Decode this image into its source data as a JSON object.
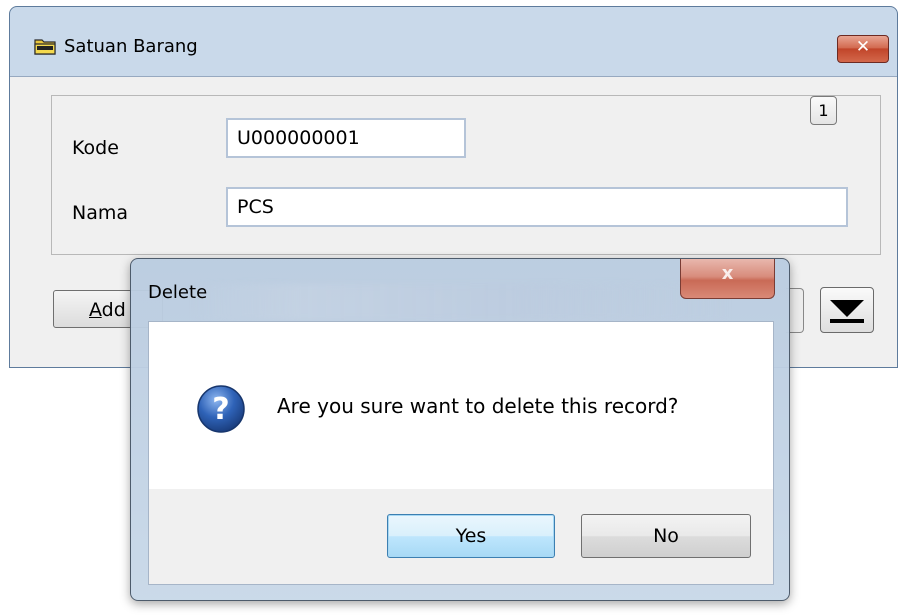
{
  "window": {
    "title": "Satuan Barang",
    "close_label": "✕"
  },
  "form": {
    "kode_label": "Kode",
    "kode_value": "U000000001",
    "nama_label": "Nama",
    "nama_value": "PCS",
    "record_number": "1"
  },
  "toolbar": {
    "add_prefix": "A",
    "add_rest": "dd"
  },
  "dialog": {
    "title": "Delete",
    "close_label": "x",
    "message": "Are you sure want to delete this record?",
    "yes_label": "Yes",
    "no_label": "No"
  },
  "colors": {
    "accent": "#3c7fb1",
    "close_red": "#c1452a",
    "question_blue": "#2a5cad"
  }
}
